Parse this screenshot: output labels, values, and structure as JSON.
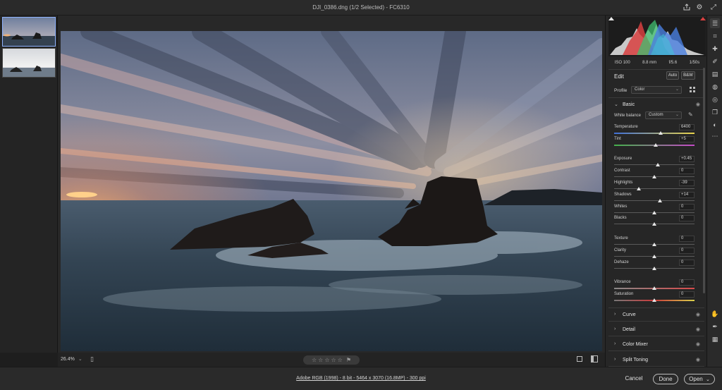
{
  "window": {
    "title": "DJI_0386.dng  (1/2 Selected)  -  FC6310"
  },
  "titlebar_icons": [
    "export-icon",
    "gear-icon",
    "expand-icon"
  ],
  "filmstrip": {
    "thumbnails": [
      "thumbnail-1",
      "thumbnail-2"
    ]
  },
  "image_toolbar": {
    "zoom": "26.4%",
    "zoom_chevron": "⌄",
    "rating": [
      "☆",
      "☆",
      "☆",
      "☆",
      "☆"
    ],
    "flag": "⚑"
  },
  "histogram": {
    "iso": "ISO 100",
    "focal": "8.8 mm",
    "aperture": "f/5.6",
    "shutter": "1/50s"
  },
  "edit": {
    "title": "Edit",
    "auto_label": "Auto",
    "bw_label": "B&W",
    "profile_label": "Profile",
    "profile_value": "Color"
  },
  "basic": {
    "section_label": "Basic",
    "white_balance_label": "White balance",
    "white_balance_value": "Custom",
    "sliders": [
      {
        "name": "Temperature",
        "value": "6400",
        "position": 0.58
      },
      {
        "name": "Tint",
        "value": "+5",
        "position": 0.52
      },
      {
        "name": "Exposure",
        "value": "+0.45",
        "position": 0.54
      },
      {
        "name": "Contrast",
        "value": "0",
        "position": 0.5
      },
      {
        "name": "Highlights",
        "value": "-39",
        "position": 0.31
      },
      {
        "name": "Shadows",
        "value": "+14",
        "position": 0.57
      },
      {
        "name": "Whites",
        "value": "0",
        "position": 0.5
      },
      {
        "name": "Blacks",
        "value": "0",
        "position": 0.5
      },
      {
        "name": "Texture",
        "value": "0",
        "position": 0.5
      },
      {
        "name": "Clarity",
        "value": "0",
        "position": 0.5
      },
      {
        "name": "Dehaze",
        "value": "0",
        "position": 0.5
      },
      {
        "name": "Vibrance",
        "value": "0",
        "position": 0.5
      },
      {
        "name": "Saturation",
        "value": "0",
        "position": 0.5
      }
    ]
  },
  "collapsed_sections": [
    "Curve",
    "Detail",
    "Color Mixer",
    "Split Toning"
  ],
  "bottom_bar": {
    "workflow": "Adobe RGB (1998) - 8 bit - 5464 x 3070 (16.8MP) - 300 ppi",
    "cancel": "Cancel",
    "done": "Done",
    "open": "Open",
    "open_chevron": "⌄"
  },
  "tool_icons": [
    "edit-sliders-icon",
    "crop-icon",
    "healing-icon",
    "brush-icon",
    "graduated-filter-icon",
    "radial-filter-icon",
    "red-eye-icon",
    "snapshots-icon",
    "presets-icon",
    "more-icon",
    "hand-icon",
    "color-sampler-icon",
    "grid-icon"
  ]
}
